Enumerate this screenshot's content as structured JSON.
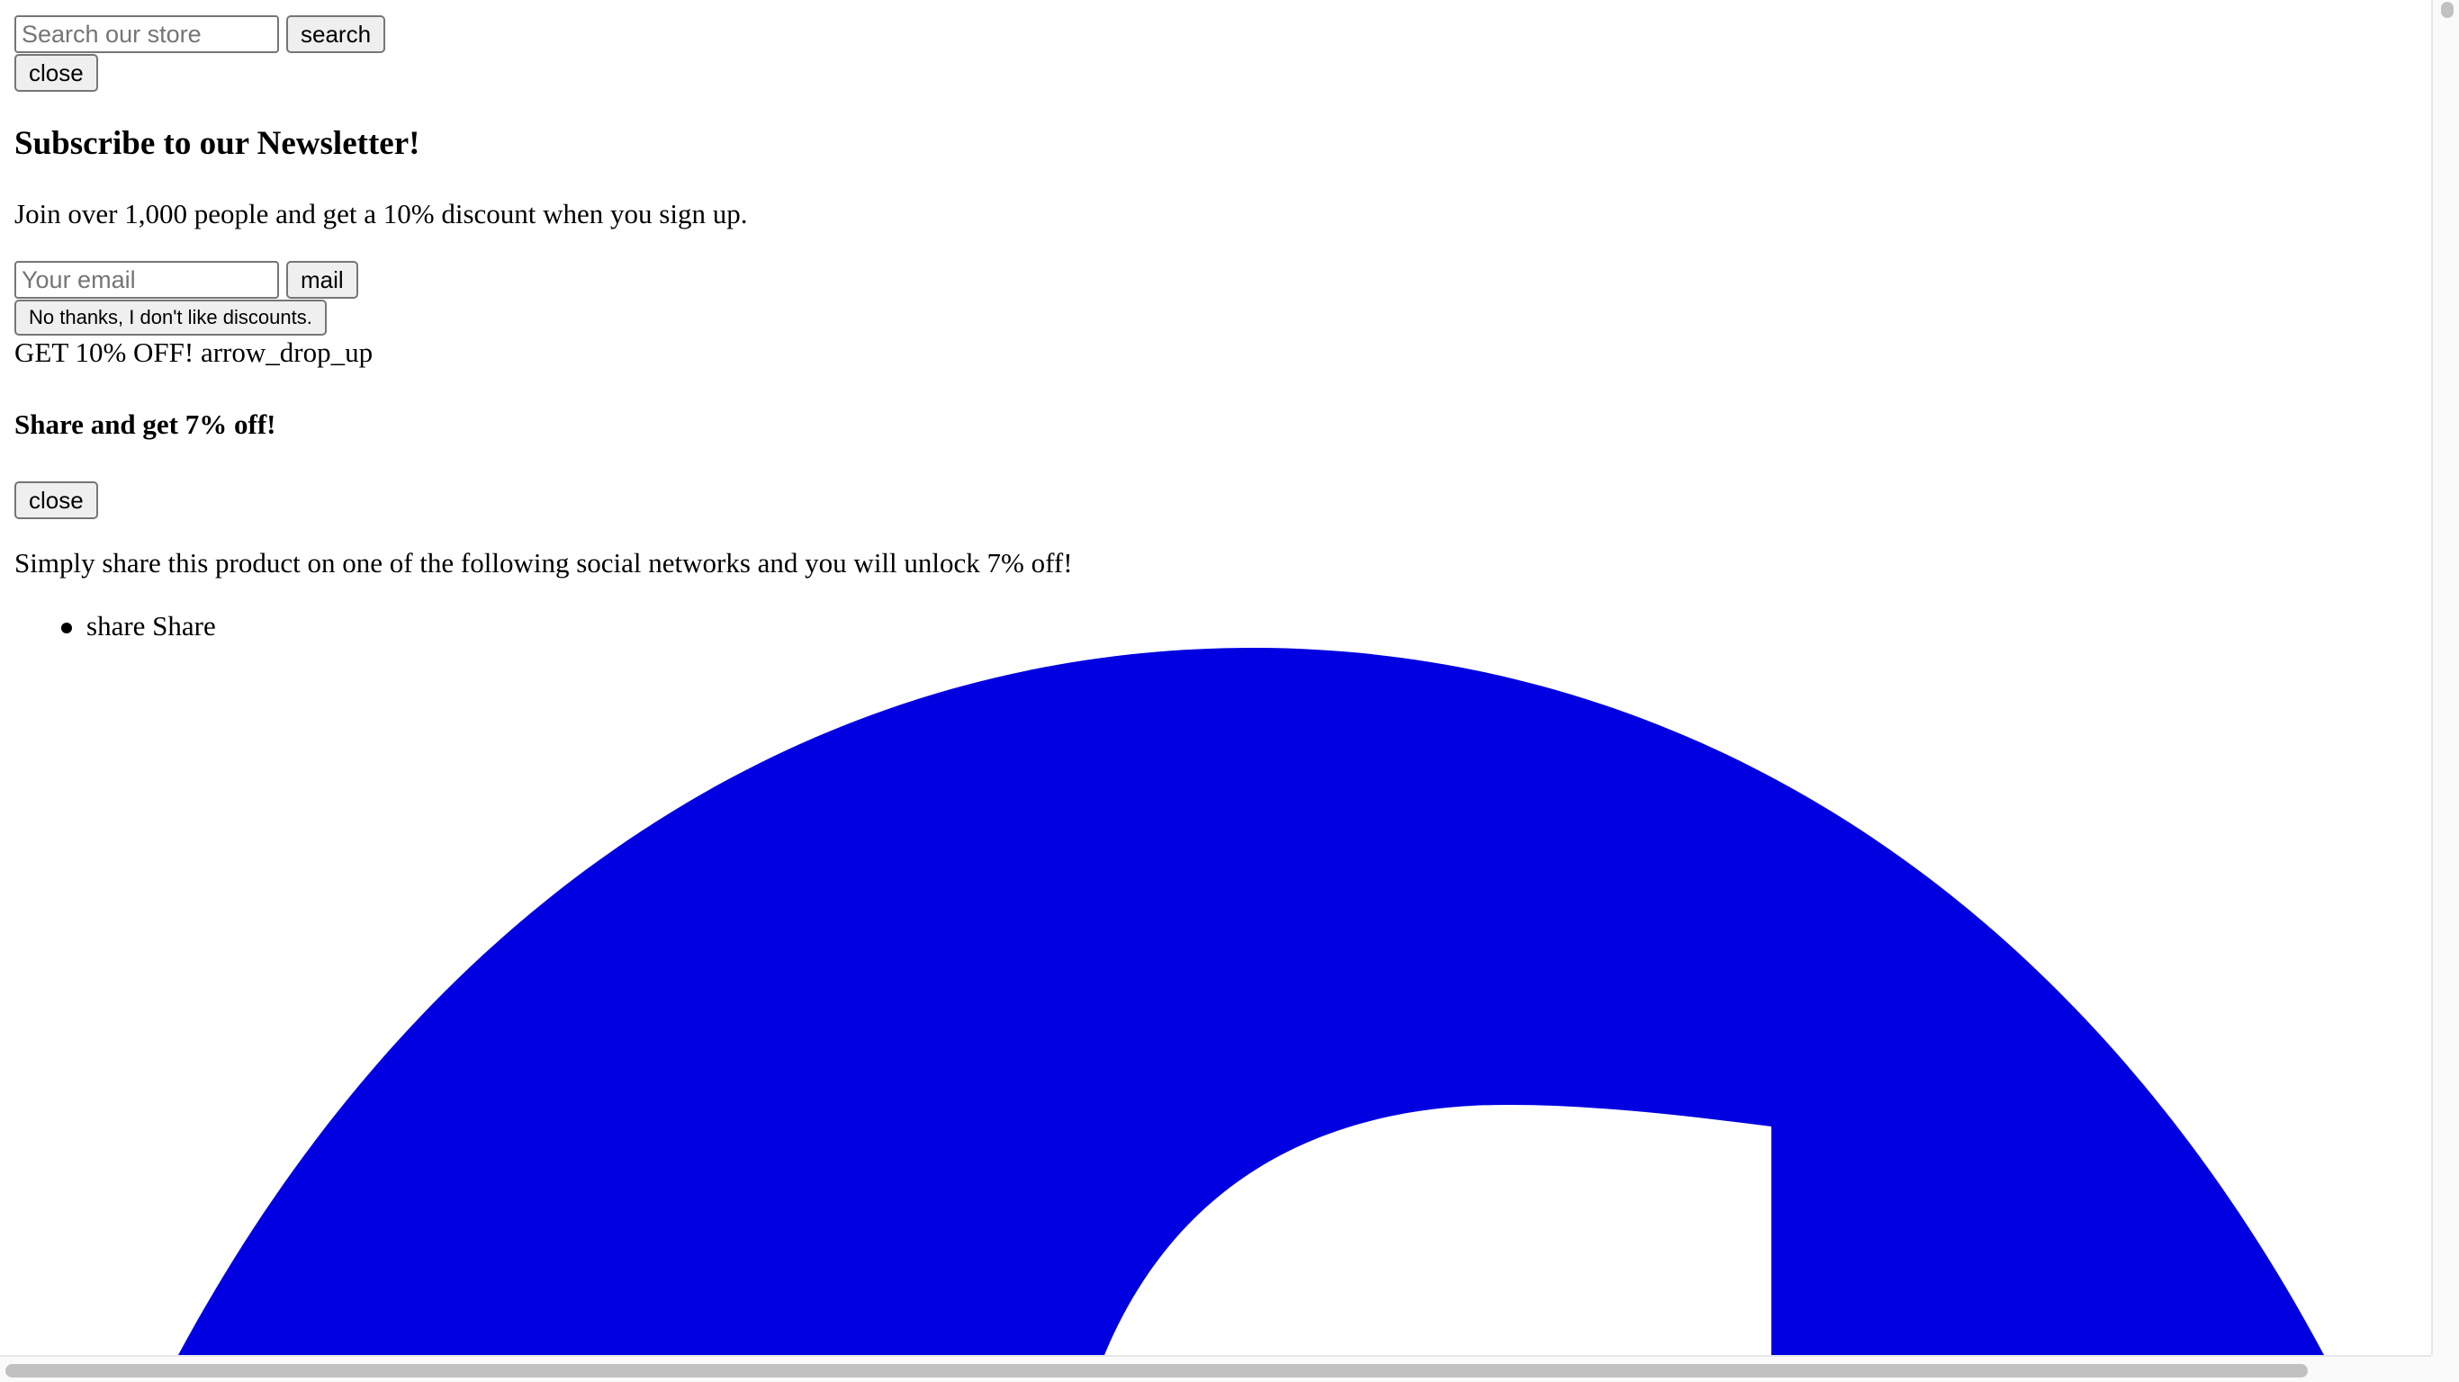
{
  "search": {
    "placeholder": "Search our store",
    "button_label": "search"
  },
  "close_top_label": "close",
  "newsletter": {
    "title": "Subscribe to our Newsletter!",
    "body": "Join over 1,000 people and get a 10% discount when you sign up.",
    "email_placeholder": "Your email",
    "submit_label": "mail",
    "decline_label": "No thanks, I don't like discounts."
  },
  "promo_toggle": "GET 10% OFF! arrow_drop_up",
  "share_panel": {
    "title": "Share and get 7% off!",
    "close_label": "close",
    "body": "Simply share this product on one of the following social networks and you will unlock 7% off!",
    "items": [
      {
        "label": "share Share"
      }
    ]
  },
  "graphic": {
    "icon": "large-blue-glyph-icon",
    "color": "#0000e1"
  },
  "colors": {
    "button_bg": "#efefef",
    "button_border": "#767676",
    "scrollbar_thumb": "#c1c1c1"
  }
}
